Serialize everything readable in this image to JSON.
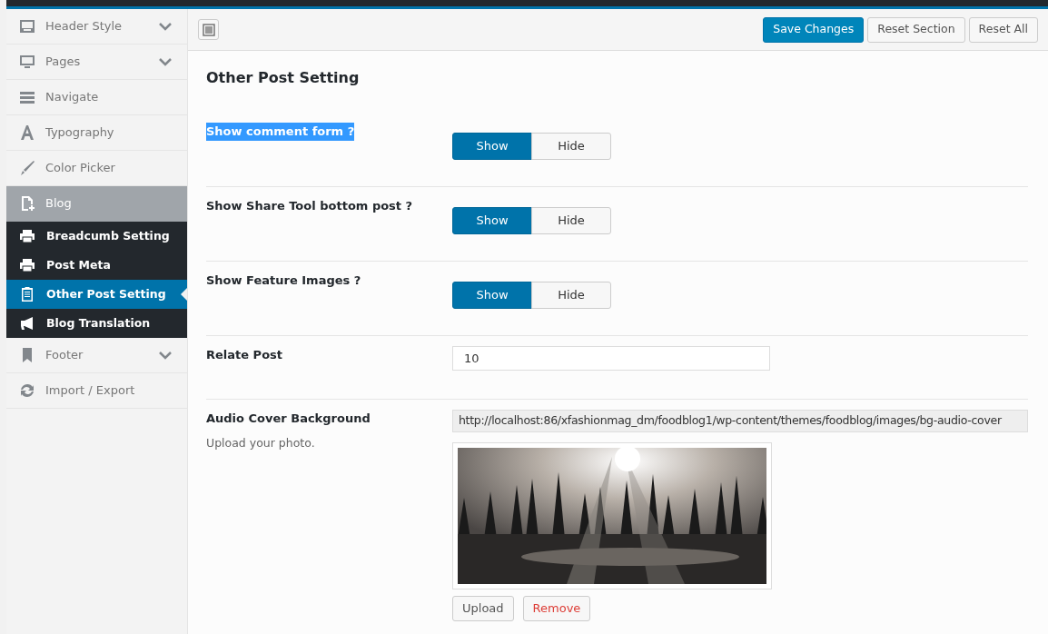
{
  "sidebar": {
    "items": [
      {
        "label": "Header Style",
        "collapsible": true,
        "selected": false
      },
      {
        "label": "Pages",
        "collapsible": true,
        "selected": false
      },
      {
        "label": "Navigate",
        "collapsible": false,
        "selected": false
      },
      {
        "label": "Typography",
        "collapsible": false,
        "selected": false
      },
      {
        "label": "Color Picker",
        "collapsible": false,
        "selected": false
      },
      {
        "label": "Blog",
        "collapsible": false,
        "selected": true,
        "children": [
          {
            "label": "Breadcumb Setting",
            "selected": false
          },
          {
            "label": "Post Meta",
            "selected": false
          },
          {
            "label": "Other Post Setting",
            "selected": true
          },
          {
            "label": "Blog Translation",
            "selected": false
          }
        ]
      },
      {
        "label": "Footer",
        "collapsible": true,
        "selected": false
      },
      {
        "label": "Import / Export",
        "collapsible": false,
        "selected": false
      }
    ]
  },
  "toolbar": {
    "buttons": [
      {
        "label": "Save Changes",
        "primary": true
      },
      {
        "label": "Reset Section",
        "primary": false
      },
      {
        "label": "Reset All",
        "primary": false
      }
    ]
  },
  "section_title": "Other Post Setting",
  "rows": [
    {
      "kind": "toggle",
      "label": "Show comment form ?",
      "highlighted": true,
      "options": [
        {
          "label": "Show",
          "selected": true
        },
        {
          "label": "Hide",
          "selected": false
        }
      ]
    },
    {
      "kind": "toggle",
      "label": "Show Share Tool bottom post ?",
      "highlighted": false,
      "options": [
        {
          "label": "Show",
          "selected": true
        },
        {
          "label": "Hide",
          "selected": false
        }
      ]
    },
    {
      "kind": "toggle",
      "label": "Show Feature Images ?",
      "highlighted": false,
      "options": [
        {
          "label": "Show",
          "selected": true
        },
        {
          "label": "Hide",
          "selected": false
        }
      ]
    },
    {
      "kind": "text",
      "label": "Relate Post",
      "value": "10"
    },
    {
      "kind": "media",
      "label": "Audio Cover Background",
      "description": "Upload your photo.",
      "url": "http://localhost:86/xfashionmag_dm/foodblog1/wp-content/themes/foodblog/images/bg-audio-cover",
      "buttons": [
        {
          "label": "Upload",
          "danger": false
        },
        {
          "label": "Remove",
          "danger": true
        }
      ]
    }
  ]
}
